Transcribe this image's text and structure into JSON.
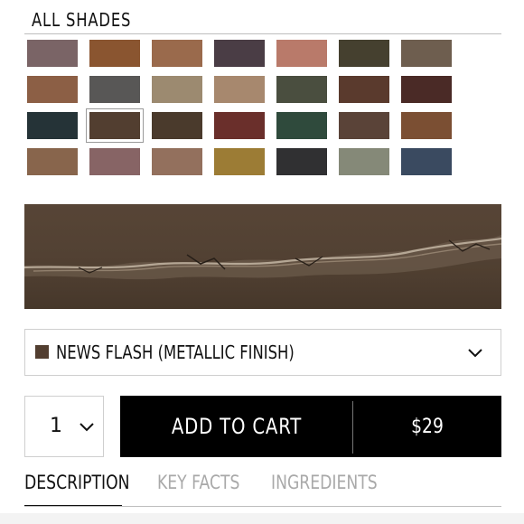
{
  "shades_heading": "ALL SHADES",
  "swatches": [
    {
      "color": "#7a6466"
    },
    {
      "color": "#8a5530"
    },
    {
      "color": "#9a6a4c"
    },
    {
      "color": "#4a3d45"
    },
    {
      "color": "#b97a6a"
    },
    {
      "color": "#45402f"
    },
    {
      "color": "#6e5e4f"
    },
    {
      "color": "#8c5f45"
    },
    {
      "color": "#585756"
    },
    {
      "color": "#9c8a70"
    },
    {
      "color": "#a7886e"
    },
    {
      "color": "#4a4e3f"
    },
    {
      "color": "#5a3a2d"
    },
    {
      "color": "#4a2a26"
    },
    {
      "color": "#253337"
    },
    {
      "color": "#523e30",
      "selected": true
    },
    {
      "color": "#4a3a2c"
    },
    {
      "color": "#6a2f2b"
    },
    {
      "color": "#2f4a3c"
    },
    {
      "color": "#5a4338"
    },
    {
      "color": "#7b4f33"
    },
    {
      "color": "#88654c"
    },
    {
      "color": "#876465"
    },
    {
      "color": "#93705d"
    },
    {
      "color": "#9c7c35"
    },
    {
      "color": "#303032"
    },
    {
      "color": "#858978"
    },
    {
      "color": "#3a4a60"
    }
  ],
  "selected_shade": {
    "label": "NEWS FLASH (METALLIC FINISH)",
    "color": "#523e30",
    "icon": "chevron-down-icon"
  },
  "quantity": {
    "value": "1",
    "icon": "chevron-down-icon"
  },
  "cart": {
    "add_label": "ADD TO CART",
    "price": "$29"
  },
  "tabs": [
    {
      "label": "DESCRIPTION",
      "active": true
    },
    {
      "label": "KEY FACTS",
      "active": false
    },
    {
      "label": "INGREDIENTS",
      "active": false
    }
  ]
}
